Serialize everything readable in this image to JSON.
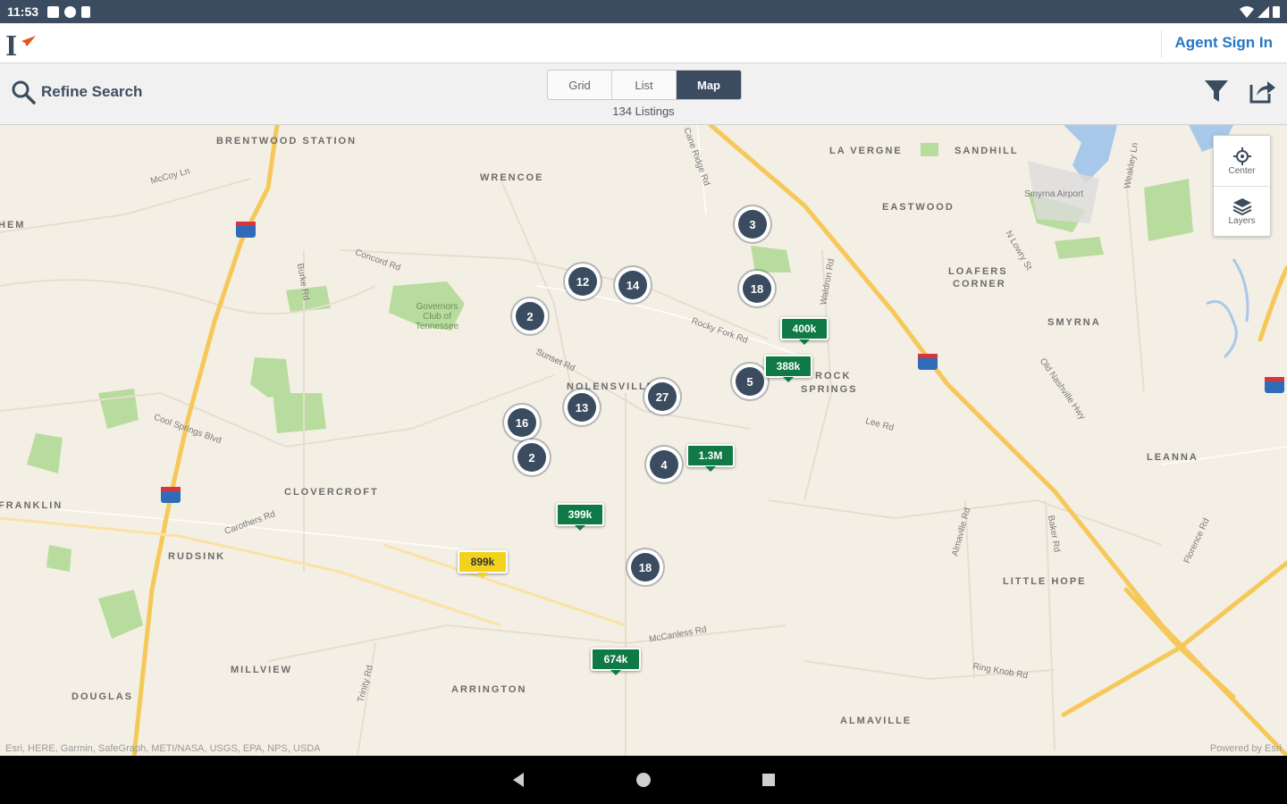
{
  "status_bar": {
    "time": "11:53"
  },
  "header": {
    "agent_sign_in": "Agent Sign In",
    "logo_icon": "brand-logo-icon"
  },
  "toolbar": {
    "refine_search": "Refine Search",
    "view_tabs": [
      {
        "label": "Grid",
        "active": false
      },
      {
        "label": "List",
        "active": false
      },
      {
        "label": "Map",
        "active": true
      }
    ],
    "listings_count": "134 Listings",
    "filter_icon": "filter-icon",
    "share_icon": "share-icon"
  },
  "map": {
    "controls": {
      "center": "Center",
      "layers": "Layers"
    },
    "places": [
      "BRENTWOOD STATION",
      "WRENCOE",
      "LA VERGNE",
      "SANDHILL",
      "EASTWOOD",
      "LOAFERS",
      "CORNER",
      "SMYRNA",
      "NOLENSVILLE",
      "ROCK",
      "SPRINGS",
      "LEANNA",
      "CLOVERCROFT",
      "FRANKLIN",
      "RUDSINK",
      "LITTLE HOPE",
      "MILLVIEW",
      "DOUGLAS",
      "ARRINGTON",
      "ALMAVILLE",
      "HEM"
    ],
    "roads": [
      "McCoy Ln",
      "Concord Rd",
      "Cane Ridge Rd",
      "Sunset Rd",
      "Cool Springs Blvd",
      "Lee Rd",
      "McCanless Rd",
      "Old Nashville Hwy",
      "Carothers Rd",
      "Almaville Rd",
      "Baker Rd",
      "Waldron Rd",
      "Burke Rd",
      "Trinity Rd",
      "Rocky Fork Rd",
      "Florence Rd",
      "Ring Knob Rd",
      "Smyrna Airport",
      "Governors Club of Tennessee",
      "N Lowry St",
      "Weakley Ln"
    ],
    "clusters": [
      "3",
      "12",
      "14",
      "18",
      "2",
      "5",
      "27",
      "13",
      "16",
      "2",
      "4",
      "18"
    ],
    "price_markers": [
      "400k",
      "388k",
      "1.3M",
      "399k",
      "899k",
      "674k"
    ],
    "attribution": "Esri, HERE, Garmin, SafeGraph, METI/NASA, USGS, EPA, NPS, USDA",
    "powered_by": "Powered by Esri"
  },
  "nav": {
    "back": "back-icon",
    "home": "home-icon",
    "recents": "recents-icon"
  }
}
